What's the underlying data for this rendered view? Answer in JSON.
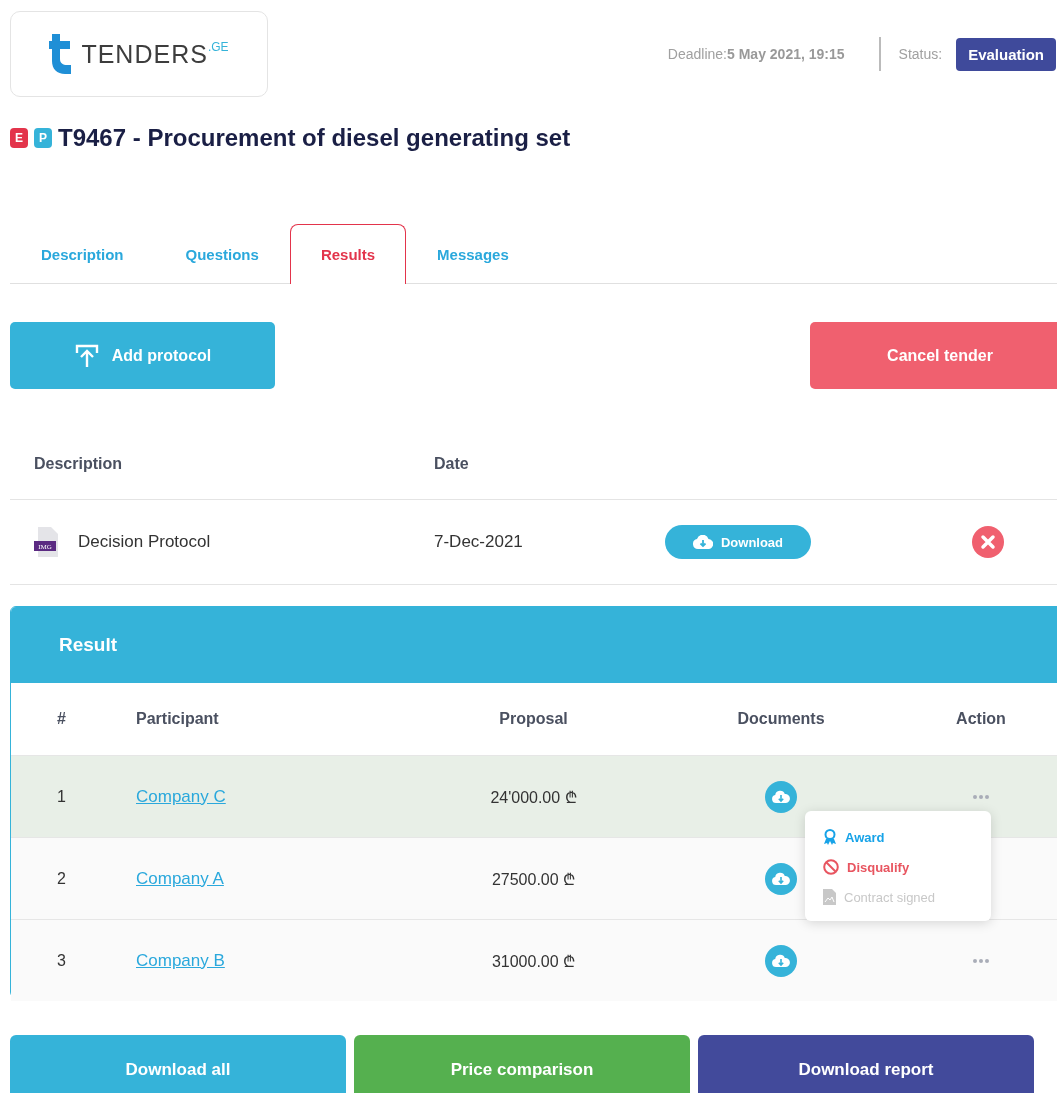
{
  "logo": {
    "name": "TENDERS",
    "suffix": ".GE"
  },
  "header": {
    "deadline_label": "Deadline:",
    "deadline": "5 May 2021, 19:15",
    "status_label": "Status:",
    "status": "Evaluation"
  },
  "title": {
    "badges": [
      {
        "text": "E",
        "color": "#e3344b"
      },
      {
        "text": "P",
        "color": "#35b3d9"
      }
    ],
    "text": "T9467 - Procurement of diesel generating set"
  },
  "tabs": [
    {
      "label": "Description",
      "selected": false
    },
    {
      "label": "Questions",
      "selected": false
    },
    {
      "label": "Results",
      "selected": true
    },
    {
      "label": "Messages",
      "selected": false
    }
  ],
  "actions": {
    "add": "Add protocol",
    "cancel": "Cancel tender"
  },
  "protocols": {
    "columns": [
      "Description",
      "Date"
    ],
    "rows": [
      {
        "name": "Decision Protocol",
        "file_type": "IMG",
        "date": "7-Dec-2021",
        "download": "Download"
      }
    ]
  },
  "result": {
    "title": "Result",
    "columns": [
      "#",
      "Participant",
      "Proposal",
      "Documents",
      "Action"
    ],
    "rows": [
      {
        "index": "1",
        "participant": "Company C",
        "proposal": "24'000.00 ₾",
        "selected": true
      },
      {
        "index": "2",
        "participant": "Company A",
        "proposal": "27500.00 ₾",
        "selected": false
      },
      {
        "index": "3",
        "participant": "Company B",
        "proposal": "31000.00 ₾",
        "selected": false
      }
    ],
    "menu": [
      {
        "kind": "award",
        "label": "Award",
        "disabled": false
      },
      {
        "kind": "disqualify",
        "label": "Disqualify",
        "disabled": false
      },
      {
        "kind": "contract",
        "label": "Contract signed",
        "disabled": true
      }
    ]
  },
  "footer_buttons": [
    {
      "kind": "download",
      "label": "Download all"
    },
    {
      "kind": "compare",
      "label": "Price comparison"
    },
    {
      "kind": "report",
      "label": "Download report"
    }
  ]
}
